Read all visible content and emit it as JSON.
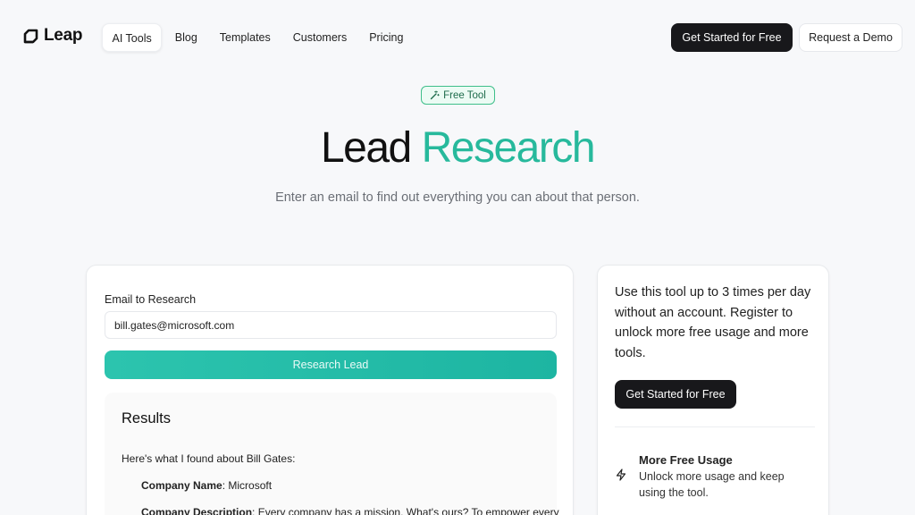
{
  "brand": {
    "name": "Leap"
  },
  "nav": {
    "items": [
      {
        "label": "AI Tools",
        "active": true
      },
      {
        "label": "Blog",
        "active": false
      },
      {
        "label": "Templates",
        "active": false
      },
      {
        "label": "Customers",
        "active": false
      },
      {
        "label": "Pricing",
        "active": false
      }
    ],
    "cta_primary": "Get Started for Free",
    "cta_secondary": "Request a Demo"
  },
  "hero": {
    "badge": "Free Tool",
    "title_part1": "Lead",
    "title_part2": "Research",
    "subtitle": "Enter an email to find out everything you can about that person."
  },
  "form": {
    "email_label": "Email to Research",
    "email_value": "bill.gates@microsoft.com",
    "submit_label": "Research Lead"
  },
  "results": {
    "title": "Results",
    "intro": "Here's what I found about Bill Gates:",
    "fields": [
      {
        "key": "Company Name",
        "value": ": Microsoft"
      },
      {
        "key": "Company Description",
        "value": ": Every company has a mission. What's ours? To empower every"
      }
    ]
  },
  "sidebar": {
    "text": "Use this tool up to 3 times per day without an account. Register to unlock more free usage and more tools.",
    "cta": "Get Started for Free",
    "feature": {
      "title": "More Free Usage",
      "description": "Unlock more usage and keep using the tool."
    }
  },
  "colors": {
    "accent": "#27b99c",
    "dark_button": "#18181b",
    "badge_border": "#3fbf8a"
  }
}
